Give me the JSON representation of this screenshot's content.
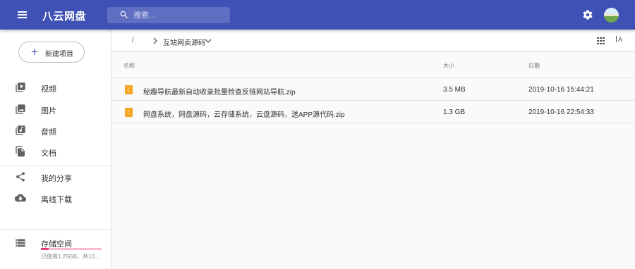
{
  "app": {
    "title": "八云网盘"
  },
  "search": {
    "placeholder": "搜索..."
  },
  "sidebar": {
    "new_button_label": "新建项目",
    "items": [
      {
        "label": "视频",
        "icon": "video-icon"
      },
      {
        "label": "图片",
        "icon": "image-icon"
      },
      {
        "label": "音频",
        "icon": "audio-icon"
      },
      {
        "label": "文档",
        "icon": "document-icon"
      },
      {
        "label": "我的分享",
        "icon": "share-icon"
      },
      {
        "label": "离线下载",
        "icon": "cloud-download-icon"
      }
    ],
    "storage": {
      "title": "存储空间",
      "usage_text": "已使用1.25GB，共10...",
      "used_fraction": 0.125
    }
  },
  "breadcrumb": {
    "root": "/",
    "current": "互站网卖源码"
  },
  "toolbar": {
    "sort_label": "A"
  },
  "columns": {
    "name": "名称",
    "size": "大小",
    "date": "日期"
  },
  "files": [
    {
      "name": "秘趣导航最新自动收录批量检查反链网站导航.zip",
      "size": "3.5 MB",
      "date": "2019-10-16 15:44:21"
    },
    {
      "name": "网盘系统，网盘源码，云存储系统，云盘源码，送APP源代码.zip",
      "size": "1.3 GB",
      "date": "2019-10-16 22:54:33"
    }
  ],
  "colors": {
    "primary": "#3f51b5",
    "accent": "#ec407a",
    "zip": "#f5a623"
  }
}
